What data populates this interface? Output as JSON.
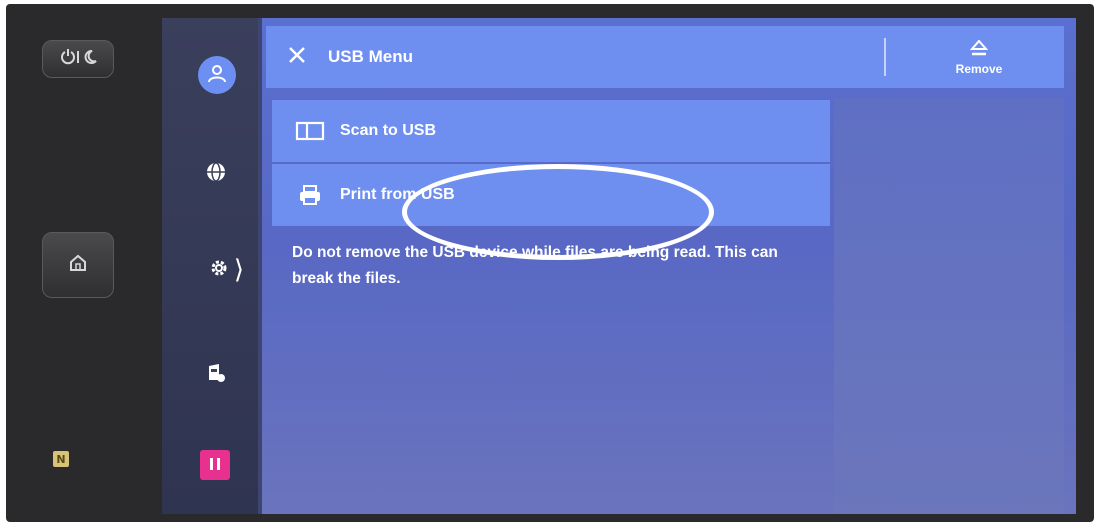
{
  "header": {
    "title": "USB Menu",
    "remove_label": "Remove"
  },
  "menu": {
    "items": [
      {
        "label": "Scan to USB",
        "icon": "scan-icon"
      },
      {
        "label": "Print from USB",
        "icon": "printer-icon"
      }
    ]
  },
  "warning_text": "Do not remove the USB device while files are being read. This can break the files.",
  "rail": {
    "icons": [
      "user-icon",
      "globe-icon",
      "gear-icon",
      "chevron-right-icon",
      "job-status-icon",
      "pause-icon"
    ]
  },
  "bezel": {
    "icons": [
      "power-sleep-icon",
      "home-icon",
      "nfc-icon"
    ],
    "nfc_mark": "N"
  },
  "colors": {
    "accent": "#6f8ff0",
    "pause": "#e8308f",
    "highlight": "#ffffff"
  }
}
